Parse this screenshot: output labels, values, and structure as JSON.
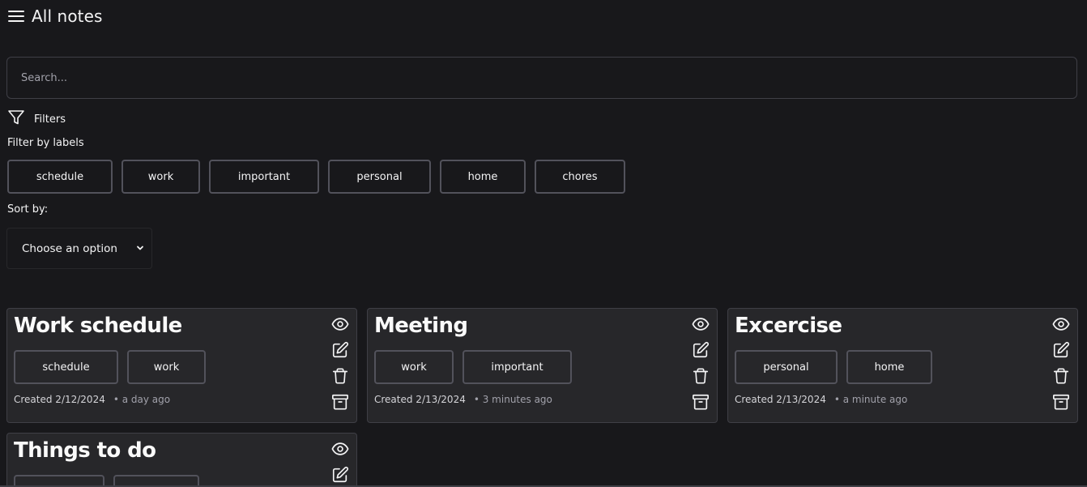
{
  "header": {
    "title": "All notes",
    "menu_icon": "hamburger-menu-icon"
  },
  "search": {
    "placeholder": "Search..."
  },
  "filters": {
    "toggle_label": "Filters",
    "filter_icon": "funnel-icon"
  },
  "labels_filter": {
    "heading": "Filter by labels",
    "labels": [
      "schedule",
      "work",
      "important",
      "personal",
      "home",
      "chores"
    ]
  },
  "sort": {
    "label": "Sort by:",
    "selected": "Choose an option"
  },
  "colors": {
    "background": "#18181b",
    "card": "#27272a",
    "border": "#52525b",
    "text": "#f4f4f5",
    "muted": "#a1a1aa"
  },
  "notes": [
    {
      "title": "Work schedule",
      "labels": [
        "schedule",
        "work"
      ],
      "created": "Created 2/12/2024",
      "ago": "• a day ago"
    },
    {
      "title": "Meeting",
      "labels": [
        "work",
        "important"
      ],
      "created": "Created 2/13/2024",
      "ago": "• 3 minutes ago"
    },
    {
      "title": "Excercise",
      "labels": [
        "personal",
        "home"
      ],
      "created": "Created 2/13/2024",
      "ago": "• a minute ago"
    },
    {
      "title": "Things to do",
      "labels": [
        "",
        ""
      ],
      "created": "",
      "ago": ""
    }
  ],
  "note_actions": [
    "eye-icon",
    "edit-icon",
    "trash-icon",
    "archive-icon"
  ]
}
